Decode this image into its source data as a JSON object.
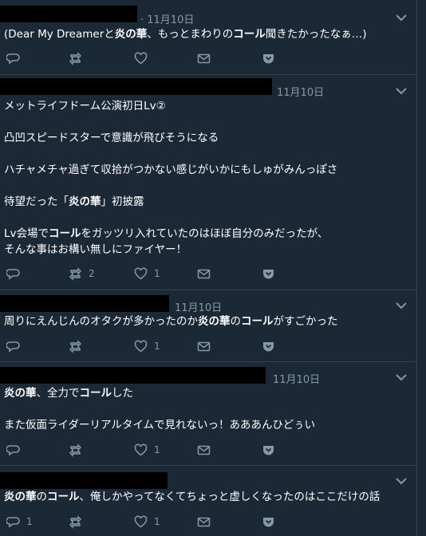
{
  "tweets": [
    {
      "date": "· 11月10日",
      "lines": [
        [
          {
            "t": "(Dear My Dreamerと"
          },
          {
            "t": "炎の華",
            "b": true
          },
          {
            "t": "、もっとまわりの"
          },
          {
            "t": "コール",
            "b": true
          },
          {
            "t": "聞きたかったなぁ…)"
          }
        ]
      ],
      "reply": "",
      "retweet": "",
      "like": ""
    },
    {
      "date": "11月10日",
      "lines": [
        [
          {
            "t": "メットライフドーム公演初日Lv②"
          }
        ],
        [],
        [
          {
            "t": "凸凹スピードスターで意識が飛びそうになる"
          }
        ],
        [],
        [
          {
            "t": "ハチャメチャ過ぎて収拾がつかない感じがいかにもしゅがみんっぽさ"
          }
        ],
        [],
        [
          {
            "t": "待望だった「"
          },
          {
            "t": "炎の華",
            "b": true
          },
          {
            "t": "」初披露"
          }
        ],
        [],
        [
          {
            "t": "Lv会場で"
          },
          {
            "t": "コール",
            "b": true
          },
          {
            "t": "をガッツリ入れていたのはほぼ自分のみだったが、"
          }
        ],
        [
          {
            "t": "そんな事はお構い無しにファイヤー！"
          }
        ]
      ],
      "reply": "",
      "retweet": "2",
      "like": "1"
    },
    {
      "date": "11月10日",
      "lines": [
        [
          {
            "t": "周りにえんじんのオタクが多かったのか"
          },
          {
            "t": "炎の華",
            "b": true
          },
          {
            "t": "の"
          },
          {
            "t": "コール",
            "b": true
          },
          {
            "t": "がすごかった"
          }
        ]
      ],
      "reply": "",
      "retweet": "",
      "like": "1"
    },
    {
      "date": "11月10日",
      "lines": [
        [
          {
            "t": "炎の華",
            "b": true
          },
          {
            "t": "、全力で"
          },
          {
            "t": "コール",
            "b": true
          },
          {
            "t": "した"
          }
        ],
        [],
        [
          {
            "t": "また仮面ライダーリアルタイムで見れないっ！あああんひどぅい"
          }
        ]
      ],
      "reply": "",
      "retweet": "",
      "like": "1"
    },
    {
      "date": "",
      "lines": [
        [
          {
            "t": "炎の華",
            "b": true
          },
          {
            "t": "の"
          },
          {
            "t": "コール",
            "b": true
          },
          {
            "t": "、俺しかやってなくてちょっと虚しくなったのはここだけの話"
          }
        ]
      ],
      "reply": "1",
      "retweet": "",
      "like": "1"
    }
  ],
  "icons": {
    "reply": "reply-icon",
    "retweet": "retweet-icon",
    "like": "heart-icon",
    "dm": "envelope-icon",
    "more": "chevron-down-icon",
    "pocket": "pocket-icon"
  },
  "colors": {
    "background": "#1b2836",
    "border": "#38444d",
    "muted": "#8899a6",
    "text": "#ffffff"
  }
}
